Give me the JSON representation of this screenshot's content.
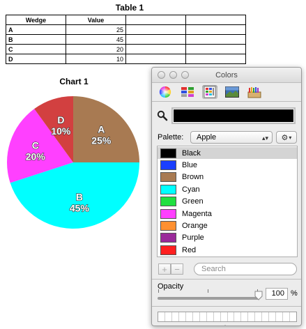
{
  "table": {
    "title": "Table 1",
    "headers": [
      "Wedge",
      "Value",
      "",
      ""
    ],
    "rows": [
      {
        "wedge": "A",
        "value": "25"
      },
      {
        "wedge": "B",
        "value": "45"
      },
      {
        "wedge": "C",
        "value": "20"
      },
      {
        "wedge": "D",
        "value": "10"
      }
    ]
  },
  "chart_data": {
    "type": "pie",
    "title": "Chart 1",
    "slices": [
      {
        "label": "A",
        "value": 25,
        "percent_label": "25%",
        "color": "#A87A52"
      },
      {
        "label": "B",
        "value": 45,
        "percent_label": "45%",
        "color": "#00FFFF"
      },
      {
        "label": "C",
        "value": 20,
        "percent_label": "20%",
        "color": "#FF40FF"
      },
      {
        "label": "D",
        "value": 10,
        "percent_label": "10%",
        "color": "#D24040"
      }
    ]
  },
  "colors_panel": {
    "title": "Colors",
    "palette_label": "Palette:",
    "palette_value": "Apple",
    "current_color": "#000000",
    "search_placeholder": "Search",
    "opacity_label": "Opacity",
    "opacity_value": "100",
    "opacity_fraction": 1.0,
    "percent_sign": "%",
    "add_label": "+",
    "remove_label": "−",
    "toolbar_icons": [
      "color-wheel-icon",
      "color-sliders-icon",
      "color-palettes-icon",
      "image-palettes-icon",
      "crayons-icon"
    ],
    "palette_colors": [
      {
        "name": "Black",
        "hex": "#000000",
        "selected": true
      },
      {
        "name": "Blue",
        "hex": "#1A3FFF"
      },
      {
        "name": "Brown",
        "hex": "#A87A52"
      },
      {
        "name": "Cyan",
        "hex": "#00FFFF"
      },
      {
        "name": "Green",
        "hex": "#20E040"
      },
      {
        "name": "Magenta",
        "hex": "#FF40FF"
      },
      {
        "name": "Orange",
        "hex": "#FF9030"
      },
      {
        "name": "Purple",
        "hex": "#9A2A9A"
      },
      {
        "name": "Red",
        "hex": "#FF2020"
      }
    ]
  }
}
